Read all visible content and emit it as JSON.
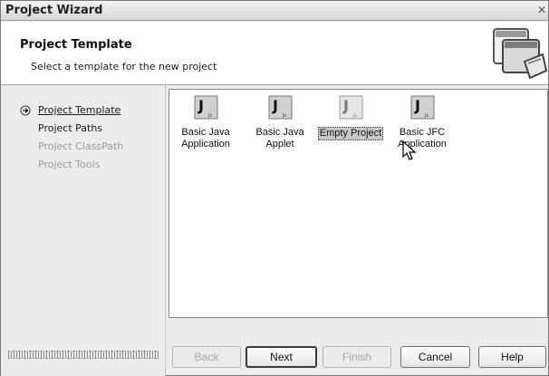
{
  "window": {
    "title": "Project Wizard",
    "close_glyph": "✕"
  },
  "header": {
    "title": "Project Template",
    "subtitle": "Select a template for the new project",
    "icon": "wizard-windows-icon"
  },
  "steps": [
    {
      "label": "Project Template",
      "state": "current"
    },
    {
      "label": "Project Paths",
      "state": "enabled"
    },
    {
      "label": "Project ClassPath",
      "state": "disabled"
    },
    {
      "label": "Project Tools",
      "state": "disabled"
    }
  ],
  "templates": [
    {
      "line1": "Basic Java",
      "line2": "Application",
      "icon": "java-file-icon",
      "selected": false
    },
    {
      "line1": "Basic Java",
      "line2": "Applet",
      "icon": "java-file-icon",
      "selected": false
    },
    {
      "line1": "Empty Project",
      "line2": "",
      "icon": "java-file-icon",
      "selected": true
    },
    {
      "line1": "Basic JFC",
      "line2": "Application",
      "icon": "java-file-icon",
      "selected": false
    }
  ],
  "buttons": {
    "back": "Back",
    "next": "Next",
    "finish": "Finish",
    "cancel": "Cancel",
    "help": "Help"
  },
  "colors": {
    "selection_bg": "#c8c8c8",
    "disabled_text": "#9c9c9c"
  }
}
